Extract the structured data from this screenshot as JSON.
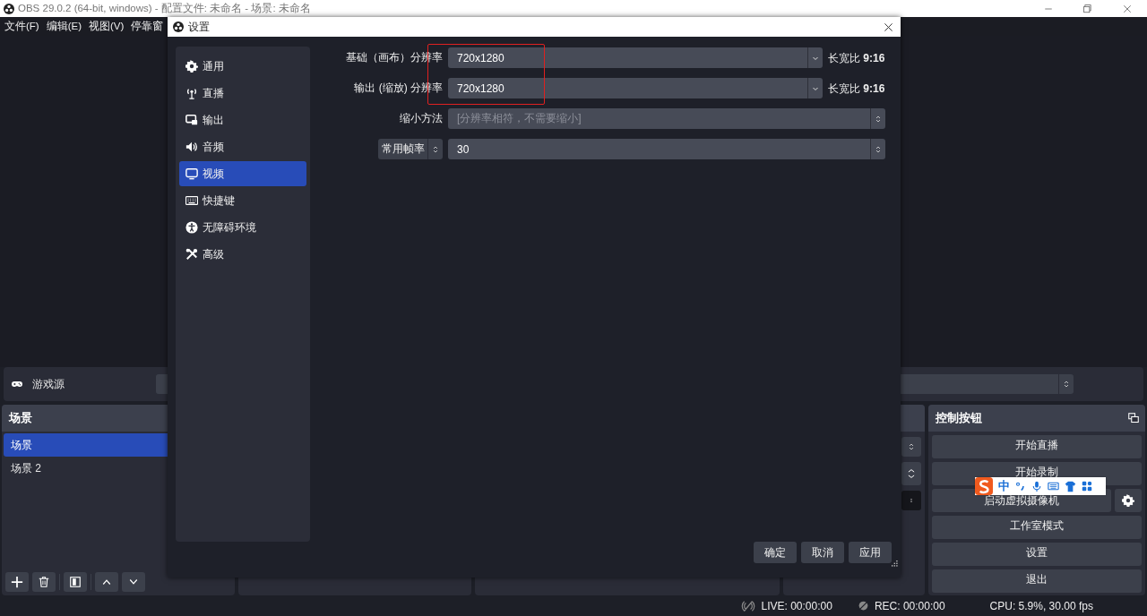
{
  "window": {
    "title": "OBS 29.0.2 (64-bit, windows) - 配置文件: 未命名 - 场景: 未命名",
    "menu": [
      "文件(F)",
      "编辑(E)",
      "视图(V)",
      "停靠窗"
    ]
  },
  "source_bar": {
    "label": "游戏源"
  },
  "scenes": {
    "title": "场景",
    "items": [
      {
        "label": "场景",
        "selected": true
      },
      {
        "label": "场景 2",
        "selected": false
      }
    ]
  },
  "controls": {
    "title": "控制按钮",
    "buttons": [
      {
        "kind": "plain",
        "label": "开始直播"
      },
      {
        "kind": "plain",
        "label": "开始录制"
      },
      {
        "kind": "with_gear",
        "label": "启动虚拟摄像机"
      },
      {
        "kind": "plain",
        "label": "工作室模式"
      },
      {
        "kind": "plain",
        "label": "设置"
      },
      {
        "kind": "plain",
        "label": "退出"
      }
    ]
  },
  "status_bar": {
    "live": "LIVE: 00:00:00",
    "rec": "REC: 00:00:00",
    "cpu": "CPU: 5.9%, 30.00 fps"
  },
  "settings_dialog": {
    "title": "设置",
    "nav": [
      {
        "label": "通用",
        "selected": false
      },
      {
        "label": "直播",
        "selected": false
      },
      {
        "label": "输出",
        "selected": false
      },
      {
        "label": "音频",
        "selected": false
      },
      {
        "label": "视频",
        "selected": true
      },
      {
        "label": "快捷键",
        "selected": false
      },
      {
        "label": "无障碍环境",
        "selected": false
      },
      {
        "label": "高级",
        "selected": false
      }
    ],
    "fields": [
      {
        "kind": "combo",
        "label": "基础（画布）分辨率",
        "value": "720x1280",
        "aspect": "长宽比 **9:16**"
      },
      {
        "kind": "combo",
        "label": "输出 (缩放) 分辨率",
        "value": "720x1280",
        "aspect": "长宽比 **9:16**"
      },
      {
        "kind": "select",
        "label": "缩小方法",
        "value": "[分辨率相符，不需要缩小]",
        "disabled": true
      },
      {
        "kind": "label_select",
        "label": "常用帧率",
        "value": "30",
        "disabled": false
      }
    ],
    "buttons": [
      "确定",
      "取消",
      "应用"
    ]
  },
  "ime_toolbar": {
    "mode": "中"
  }
}
